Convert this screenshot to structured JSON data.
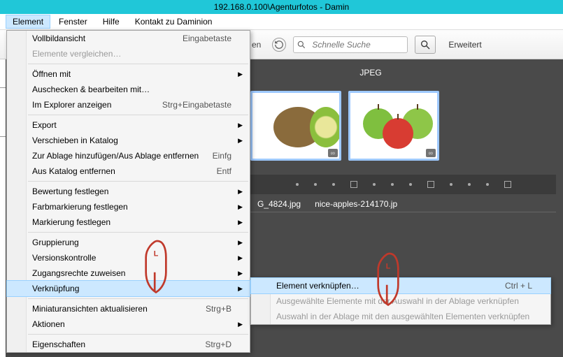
{
  "titlebar": "192.168.0.100\\Agenturfotos - Damin",
  "menubar": [
    "Element",
    "Fenster",
    "Hilfe",
    "Kontakt zu Daminion"
  ],
  "toolbar": {
    "search_placeholder": "Schnelle Suche",
    "advanced": "Erweitert"
  },
  "content": {
    "format_label": "JPEG",
    "captions": [
      "G_4824.jpg",
      "nice-apples-214170.jp"
    ]
  },
  "menu": {
    "items": [
      {
        "label": "Vollbildansicht",
        "shortcut": "Eingabetaste"
      },
      {
        "label": "Elemente vergleichen…",
        "disabled": true
      },
      {
        "sep": true
      },
      {
        "label": "Öffnen mit",
        "arrow": true
      },
      {
        "label": "Auschecken & bearbeiten mit…"
      },
      {
        "label": "Im Explorer anzeigen",
        "shortcut": "Strg+Eingabetaste"
      },
      {
        "sep": true
      },
      {
        "label": "Export",
        "arrow": true
      },
      {
        "label": "Verschieben in Katalog",
        "arrow": true
      },
      {
        "label": "Zur Ablage hinzufügen/Aus Ablage entfernen",
        "shortcut": "Einfg"
      },
      {
        "label": "Aus Katalog entfernen",
        "shortcut": "Entf"
      },
      {
        "sep": true
      },
      {
        "label": "Bewertung festlegen",
        "arrow": true
      },
      {
        "label": "Farbmarkierung festlegen",
        "arrow": true
      },
      {
        "label": "Markierung festlegen",
        "arrow": true
      },
      {
        "sep": true
      },
      {
        "label": "Gruppierung",
        "arrow": true
      },
      {
        "label": "Versionskontrolle",
        "arrow": true
      },
      {
        "label": "Zugangsrechte zuweisen",
        "arrow": true
      },
      {
        "label": "Verknüpfung",
        "arrow": true,
        "highlight": true
      },
      {
        "sep": true
      },
      {
        "label": "Miniaturansichten aktualisieren",
        "shortcut": "Strg+B"
      },
      {
        "label": "Aktionen",
        "arrow": true
      },
      {
        "sep": true
      },
      {
        "label": "Eigenschaften",
        "shortcut": "Strg+D"
      }
    ]
  },
  "submenu": {
    "items": [
      {
        "label": "Element verknüpfen…",
        "shortcut": "Ctrl + L",
        "highlight": true
      },
      {
        "label": "Ausgewählte Elemente mit der Auswahl in der Ablage verknüpfen",
        "disabled": true
      },
      {
        "label": "Auswahl in der Ablage mit den ausgewählten Elementen verknüpfen",
        "disabled": true
      }
    ]
  },
  "cursor_letter": "L"
}
